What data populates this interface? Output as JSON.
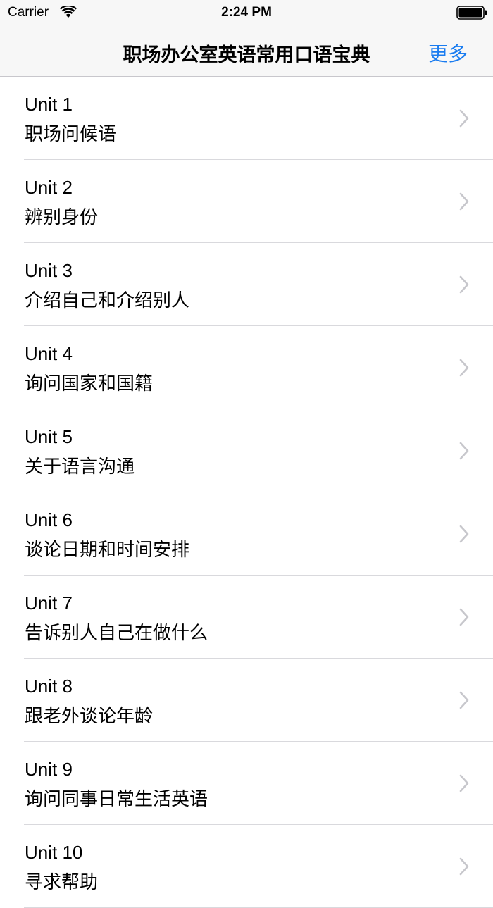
{
  "status_bar": {
    "carrier": "Carrier",
    "time": "2:24 PM",
    "wifi_icon": "wifi-icon",
    "battery_icon": "battery-icon"
  },
  "nav": {
    "title": "职场办公室英语常用口语宝典",
    "more_label": "更多",
    "accent_color": "#1a7cf0"
  },
  "list": {
    "chevron_icon": "chevron-right-icon",
    "items": [
      {
        "unit": "Unit 1",
        "title": "职场问候语"
      },
      {
        "unit": "Unit 2",
        "title": " 辨别身份"
      },
      {
        "unit": "Unit 3",
        "title": " 介绍自己和介绍别人"
      },
      {
        "unit": "Unit 4",
        "title": " 询问国家和国籍"
      },
      {
        "unit": "Unit 5",
        "title": "关于语言沟通"
      },
      {
        "unit": "Unit 6",
        "title": "谈论日期和时间安排"
      },
      {
        "unit": "Unit 7",
        "title": "告诉别人自己在做什么"
      },
      {
        "unit": "Unit 8",
        "title": "跟老外谈论年龄"
      },
      {
        "unit": "Unit 9",
        "title": "询问同事日常生活英语"
      },
      {
        "unit": "Unit 10",
        "title": "寻求帮助"
      }
    ]
  }
}
